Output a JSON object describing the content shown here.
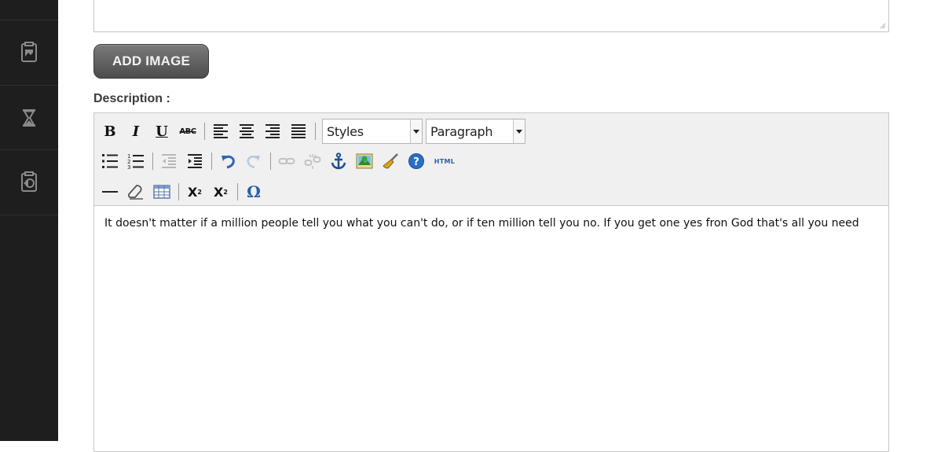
{
  "sidebar": {
    "items": [
      {
        "icon": "gallery-icon"
      },
      {
        "icon": "hourglass-icon"
      },
      {
        "icon": "back-arrow-icon"
      }
    ]
  },
  "form": {
    "add_image_label": "ADD IMAGE",
    "description_label": "Description :"
  },
  "editor": {
    "styles_select": {
      "value": "Styles"
    },
    "format_select": {
      "value": "Paragraph"
    },
    "toolbar_glyphs": {
      "bold": "B",
      "italic": "I",
      "underline": "U",
      "strikethrough": "ABC",
      "html": "HTML",
      "subscript": "X",
      "subscript_mark": "2",
      "superscript": "X",
      "superscript_mark": "2",
      "special_char": "Ω"
    },
    "content": "It doesn't matter if a million people tell you what you can't do, or if ten million tell you no. If you get one yes fron God that's all you need"
  }
}
